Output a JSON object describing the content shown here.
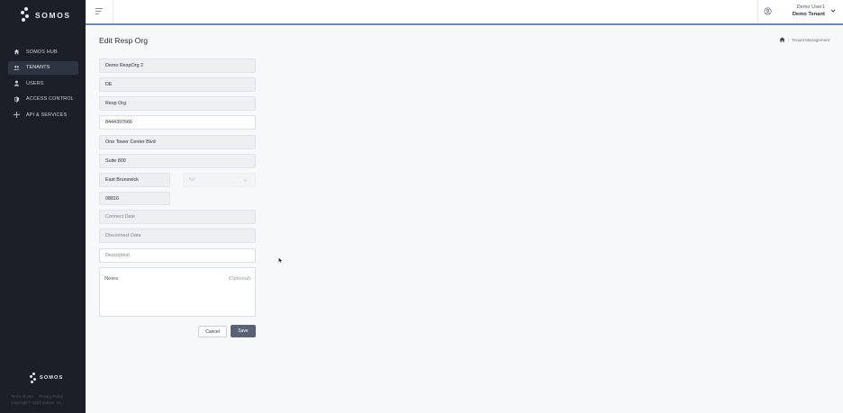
{
  "sidebar": {
    "brand": "SOMOS",
    "items": [
      {
        "label": "SOMOS HUB",
        "icon": "home-icon"
      },
      {
        "label": "TENANTS",
        "icon": "users-group-icon"
      },
      {
        "label": "USERS",
        "icon": "user-icon"
      },
      {
        "label": "ACCESS CONTROL",
        "icon": "shield-icon"
      },
      {
        "label": "API & SERVICES",
        "icon": "api-icon"
      }
    ],
    "active_item": "TENANTS",
    "footer_brand": "SOMOS",
    "footer_links": [
      "Terms of Use",
      "Privacy Policy"
    ],
    "copyright": "Copyright © 2024 Somos, Inc."
  },
  "header": {
    "user_name": "Demo User1",
    "tenant_name": "Demo Tenant"
  },
  "page": {
    "title": "Edit Resp Org",
    "breadcrumb": [
      "Tenant Management"
    ]
  },
  "form": {
    "name": "Demo RespOrg 2",
    "code": "DE",
    "type": "Resp Org",
    "phone": "8444397666",
    "address1": "One Tower Center Blvd",
    "address2": "Suite 800",
    "city": "East Brunswick",
    "state": "NJ",
    "zip": "08816",
    "connect_date_placeholder": "Connect Date",
    "disconnect_date_placeholder": "Disconnect Date",
    "description_placeholder": "Description",
    "notes_label": "Notes",
    "notes_optional": "(Optional)",
    "cancel_label": "Cancel",
    "save_label": "Save"
  },
  "colors": {
    "sidebar_bg": "#1b1f28",
    "accent_line": "#6f8ab1",
    "save_button": "#5b6278"
  }
}
